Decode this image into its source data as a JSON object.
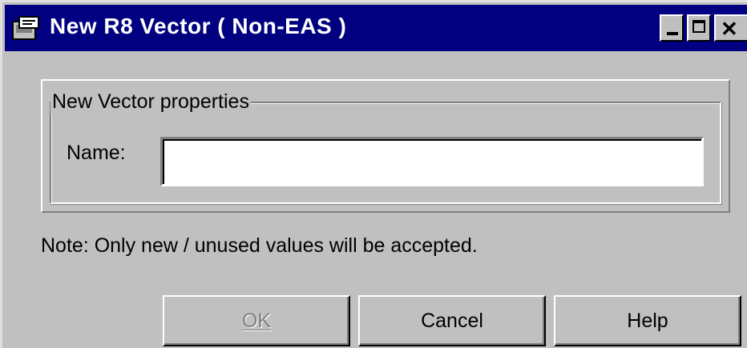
{
  "window": {
    "title": "New R8 Vector ( Non-EAS )",
    "icon": "application-icon"
  },
  "titlebar_controls": {
    "minimize_icon": "minimize-icon",
    "maximize_icon": "maximize-icon",
    "close_glyph": "✕"
  },
  "group": {
    "legend": "New Vector properties",
    "name_label": "Name:",
    "name_value": ""
  },
  "note": "Note: Only new / unused values will be accepted.",
  "buttons": {
    "ok": "OK",
    "cancel": "Cancel",
    "help": "Help"
  },
  "colors": {
    "titlebar": "#000080",
    "face": "#c0c0c0",
    "disabled_text": "#808080"
  }
}
